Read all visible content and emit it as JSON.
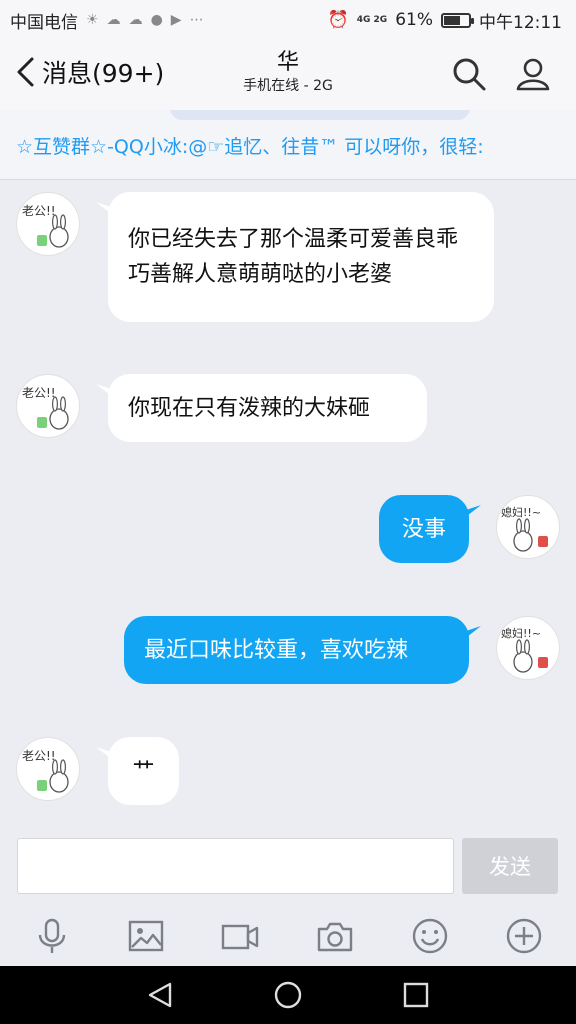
{
  "status_bar": {
    "carrier": "中国电信",
    "network": "4G 2G",
    "battery": "61%",
    "battery_level": 0.61,
    "time": "中午12:11"
  },
  "header": {
    "back_label": "消息(99+)",
    "title": "华",
    "subtitle": "手机在线 - 2G"
  },
  "notice": {
    "text": "☆互赞群☆-QQ小冰:@☞追忆、往昔™ 可以呀你，很轻:"
  },
  "avatars": {
    "husband_caption": "老公！！",
    "wife_caption": "媳妇！！~"
  },
  "messages": [
    {
      "side": "in",
      "text": "你已经失去了那个温柔可爱善良乖巧善解人意萌萌哒的小老婆"
    },
    {
      "side": "in",
      "text": "你现在只有泼辣的大妹砸"
    },
    {
      "side": "out",
      "text": "没事"
    },
    {
      "side": "out",
      "text": "最近口味比较重，喜欢吃辣"
    },
    {
      "side": "in",
      "text": "艹"
    }
  ],
  "composer": {
    "input_value": "",
    "send_label": "发送"
  },
  "toolbar": [
    "microphone-icon",
    "image-icon",
    "video-icon",
    "camera-icon",
    "emoji-icon",
    "plus-icon"
  ],
  "colors": {
    "accent": "#12a5f4",
    "notice_text": "#1f9bf2",
    "chat_bg": "#ebedf2"
  }
}
